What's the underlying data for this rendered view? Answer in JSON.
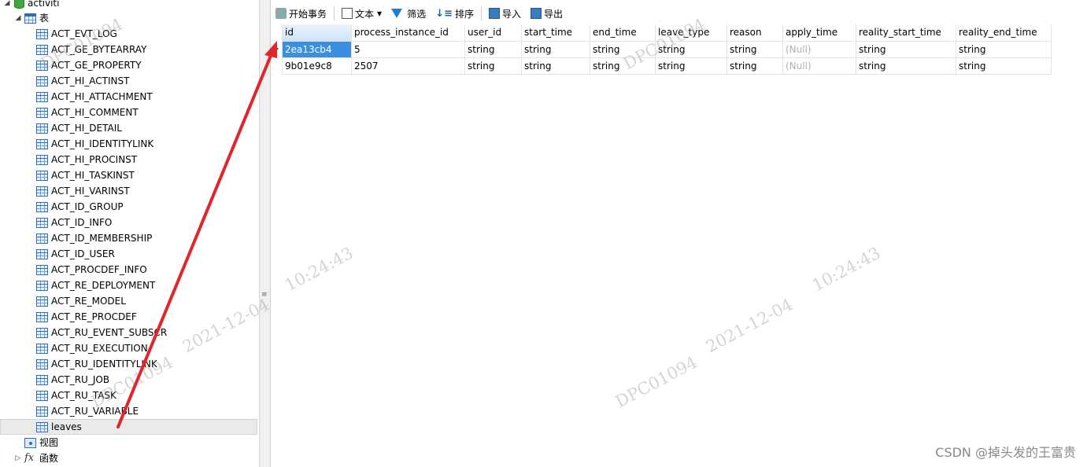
{
  "tree": {
    "database": "activiti",
    "tables_node": "表",
    "tables": [
      "ACT_EVT_LOG",
      "ACT_GE_BYTEARRAY",
      "ACT_GE_PROPERTY",
      "ACT_HI_ACTINST",
      "ACT_HI_ATTACHMENT",
      "ACT_HI_COMMENT",
      "ACT_HI_DETAIL",
      "ACT_HI_IDENTITYLINK",
      "ACT_HI_PROCINST",
      "ACT_HI_TASKINST",
      "ACT_HI_VARINST",
      "ACT_ID_GROUP",
      "ACT_ID_INFO",
      "ACT_ID_MEMBERSHIP",
      "ACT_ID_USER",
      "ACT_PROCDEF_INFO",
      "ACT_RE_DEPLOYMENT",
      "ACT_RE_MODEL",
      "ACT_RE_PROCDEF",
      "ACT_RU_EVENT_SUBSCR",
      "ACT_RU_EXECUTION",
      "ACT_RU_IDENTITYLINK",
      "ACT_RU_JOB",
      "ACT_RU_TASK",
      "ACT_RU_VARIABLE",
      "leaves"
    ],
    "views_node": "视图",
    "functions_node": "函数"
  },
  "toolbar": {
    "begin_transaction": "开始事务",
    "text": "文本",
    "filter": "筛选",
    "sort": "排序",
    "import": "导入",
    "export": "导出"
  },
  "grid": {
    "columns": [
      "id",
      "process_instance_id",
      "user_id",
      "start_time",
      "end_time",
      "leave_type",
      "reason",
      "apply_time",
      "reality_start_time",
      "reality_end_time"
    ],
    "rows": [
      [
        "2ea13cb4",
        "5",
        "string",
        "string",
        "string",
        "string",
        "string",
        "(Null)",
        "string",
        "string"
      ],
      [
        "9b01e9c8",
        "2507",
        "string",
        "string",
        "string",
        "string",
        "string",
        "(Null)",
        "string",
        "string"
      ]
    ]
  },
  "watermark": {
    "user": "DPC01094",
    "date": "2021-12-04",
    "time": "10:24:43"
  },
  "credit": "CSDN @掉头发的王富贵",
  "colors": {
    "selection": "#3b8ee0",
    "arrow": "#e0262b"
  }
}
